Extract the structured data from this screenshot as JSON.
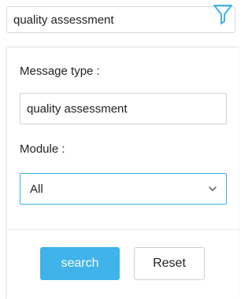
{
  "search_bar": {
    "value": "quality assessment",
    "filter_icon": "filter-icon",
    "accent_color": "#3fb3ea"
  },
  "filter_panel": {
    "message_type_label": "Message type :",
    "message_type_value": "quality assessment",
    "module_label": "Module :",
    "module_selected": "All",
    "dropdown_icon": "chevron-down-icon",
    "search_label": "search",
    "reset_label": "Reset"
  }
}
